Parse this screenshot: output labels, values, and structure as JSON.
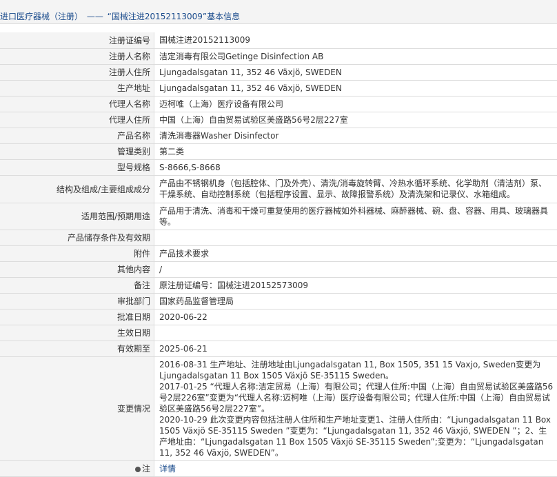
{
  "header": {
    "category": "进口医疗器械（注册）",
    "dash": "——",
    "title": "“国械注进20152113009”基本信息"
  },
  "rows": [
    {
      "label": "注册证编号",
      "value": "国械注进20152113009"
    },
    {
      "label": "注册人名称",
      "value": "洁定消毒有限公司Getinge Disinfection AB"
    },
    {
      "label": "注册人住所",
      "value": "Ljungadalsgatan 11, 352 46 Växjö, SWEDEN"
    },
    {
      "label": "生产地址",
      "value": "Ljungadalsgatan 11, 352 46 Växjö, SWEDEN"
    },
    {
      "label": "代理人名称",
      "value": "迈柯唯（上海）医疗设备有限公司"
    },
    {
      "label": "代理人住所",
      "value": "中国（上海）自由贸易试验区美盛路56号2层227室"
    },
    {
      "label": "产品名称",
      "value": "清洗消毒器Washer Disinfector"
    },
    {
      "label": "管理类别",
      "value": "第二类"
    },
    {
      "label": "型号规格",
      "value": "S-8666,S-8668"
    },
    {
      "label": "结构及组成/主要组成成分",
      "value": "产品由不锈钢机身（包括腔体、门及外壳）、清洗/消毒旋转臂、冷热水循环系统、化学助剂（清洁剂）泵、干燥系统、自动控制系统（包括程序设置、显示、故障报警系统）及清洗架和记录仪、水箱组成。"
    },
    {
      "label": "适用范围/预期用途",
      "value": "产品用于清洗、消毒和干燥可重复使用的医疗器械如外科器械、麻醉器械、碗、盘、容器、用具、玻璃器具等。"
    },
    {
      "label": "产品储存条件及有效期",
      "value": ""
    },
    {
      "label": "附件",
      "value": "产品技术要求"
    },
    {
      "label": "其他内容",
      "value": "/"
    },
    {
      "label": "备注",
      "value": "原注册证编号：国械注进20152573009"
    },
    {
      "label": "审批部门",
      "value": "国家药品监督管理局"
    },
    {
      "label": "批准日期",
      "value": "2020-06-22"
    },
    {
      "label": "生效日期",
      "value": ""
    },
    {
      "label": "有效期至",
      "value": "2025-06-21"
    }
  ],
  "change": {
    "label": "变更情况",
    "lines": [
      "2016-08-31 生产地址、注册地址由Ljungadalsgatan 11, Box 1505, 351 15 Vaxjo, Sweden变更为Ljungadalsgatan 11 Box 1505 Växjö SE-35115 Sweden。",
      "2017-01-25 “代理人名称:洁定贸易（上海）有限公司；代理人住所:中国（上海）自由贸易试验区美盛路56号2层226室”变更为“代理人名称:迈柯唯（上海）医疗设备有限公司；代理人住所:中国（上海）自由贸易试验区美盛路56号2层227室”。",
      "2020-10-29 此次变更内容包括注册人住所和生产地址变更1、注册人住所由：“Ljungadalsgatan 11 Box 1505 Växjö SE-35115 Sweden ”变更为：“Ljungadalsgatan 11, 352 46 Växjö, SWEDEN ”；2、生产地址由：“Ljungadalsgatan 11 Box 1505 Växjö SE-35115 Sweden”;变更为：“Ljungadalsgatan 11, 352 46 Växjö, SWEDEN”。"
    ]
  },
  "note": {
    "label": "注",
    "link": "详情"
  }
}
